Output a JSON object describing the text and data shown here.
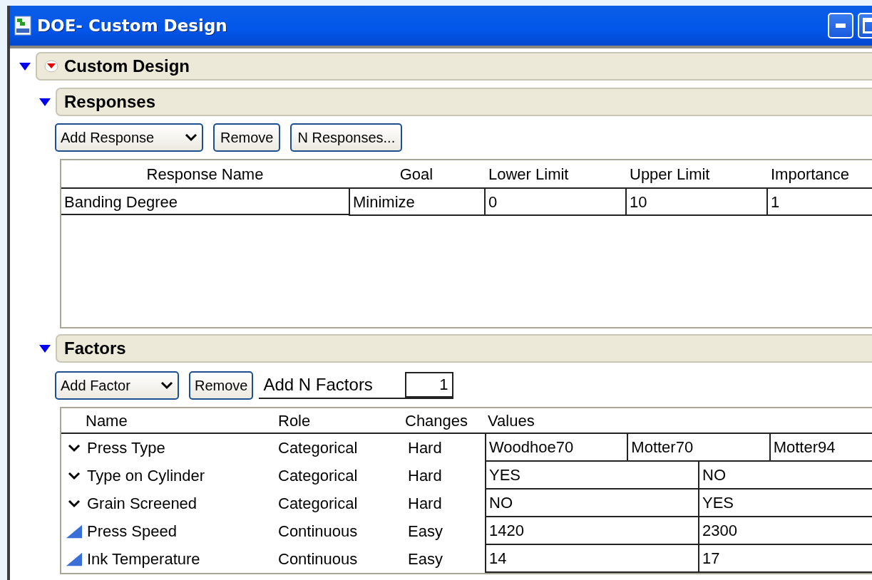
{
  "window": {
    "title": "DOE- Custom Design"
  },
  "outline": {
    "title": "Custom Design",
    "expanded": true
  },
  "responses": {
    "title": "Responses",
    "expanded": true,
    "add_select": "Add Response",
    "buttons": [
      "Remove",
      "N Responses..."
    ],
    "columns": [
      "Response Name",
      "Goal",
      "Lower Limit",
      "Upper Limit",
      "Importance"
    ],
    "rows": [
      [
        "Banding Degree",
        "Minimize",
        "0",
        "10",
        "1"
      ]
    ]
  },
  "factors": {
    "title": "Factors",
    "expanded": true,
    "add_select": "Add Factor",
    "remove_button": "Remove",
    "add_n_label": "Add N Factors",
    "add_n_value": "1",
    "columns": [
      "Name",
      "Role",
      "Changes",
      "Values"
    ],
    "rows": [
      {
        "kind": "categorical",
        "name": "Press Type",
        "role": "Categorical",
        "changes": "Hard",
        "values": [
          "Woodhoe70",
          "Motter70",
          "Motter94"
        ]
      },
      {
        "kind": "categorical",
        "name": "Type on Cylinder",
        "role": "Categorical",
        "changes": "Hard",
        "values": [
          "YES",
          "NO"
        ]
      },
      {
        "kind": "categorical",
        "name": "Grain Screened",
        "role": "Categorical",
        "changes": "Hard",
        "values": [
          "NO",
          "YES"
        ]
      },
      {
        "kind": "continuous",
        "name": "Press Speed",
        "role": "Continuous",
        "changes": "Easy",
        "values": [
          "1420",
          "2300"
        ]
      },
      {
        "kind": "continuous",
        "name": "Ink Temperature",
        "role": "Continuous",
        "changes": "Easy",
        "values": [
          "14",
          "17"
        ]
      }
    ]
  }
}
